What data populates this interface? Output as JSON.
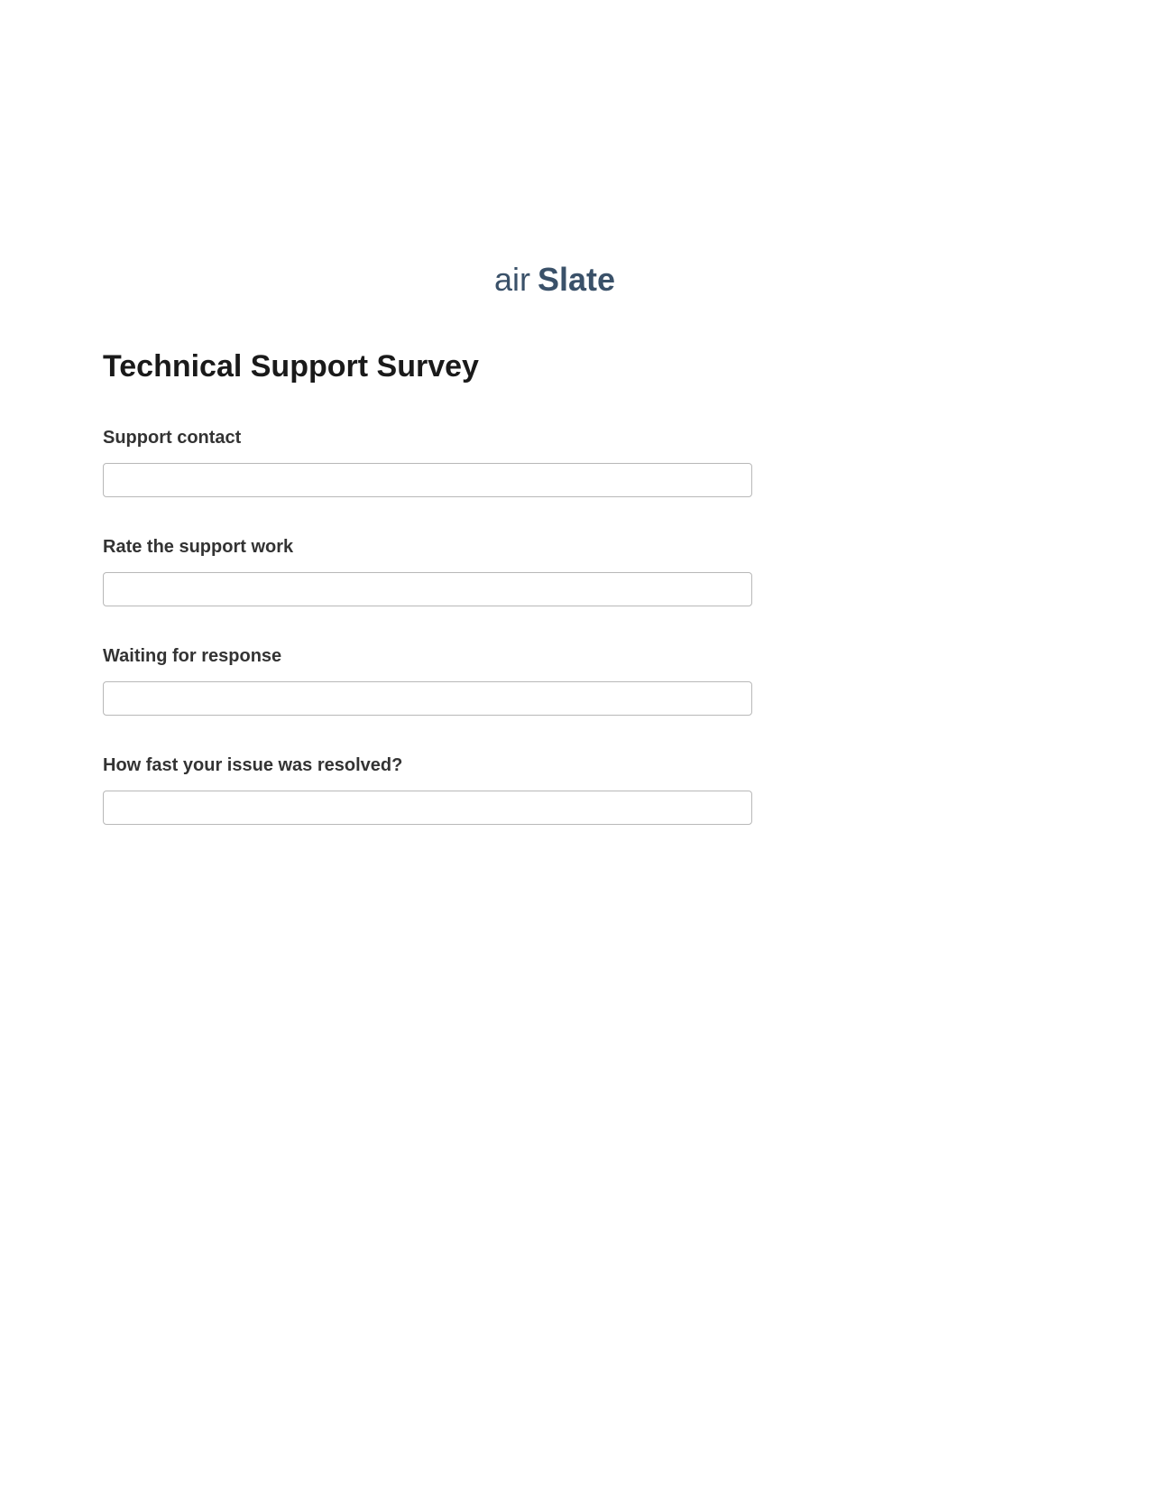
{
  "logo": {
    "text_light": "air",
    "text_bold": "Slate",
    "color": "#3a5169"
  },
  "title": "Technical Support Survey",
  "fields": [
    {
      "label": "Support contact",
      "value": ""
    },
    {
      "label": "Rate the support work",
      "value": ""
    },
    {
      "label": "Waiting for response",
      "value": ""
    },
    {
      "label": "How fast your issue was resolved?",
      "value": ""
    }
  ]
}
